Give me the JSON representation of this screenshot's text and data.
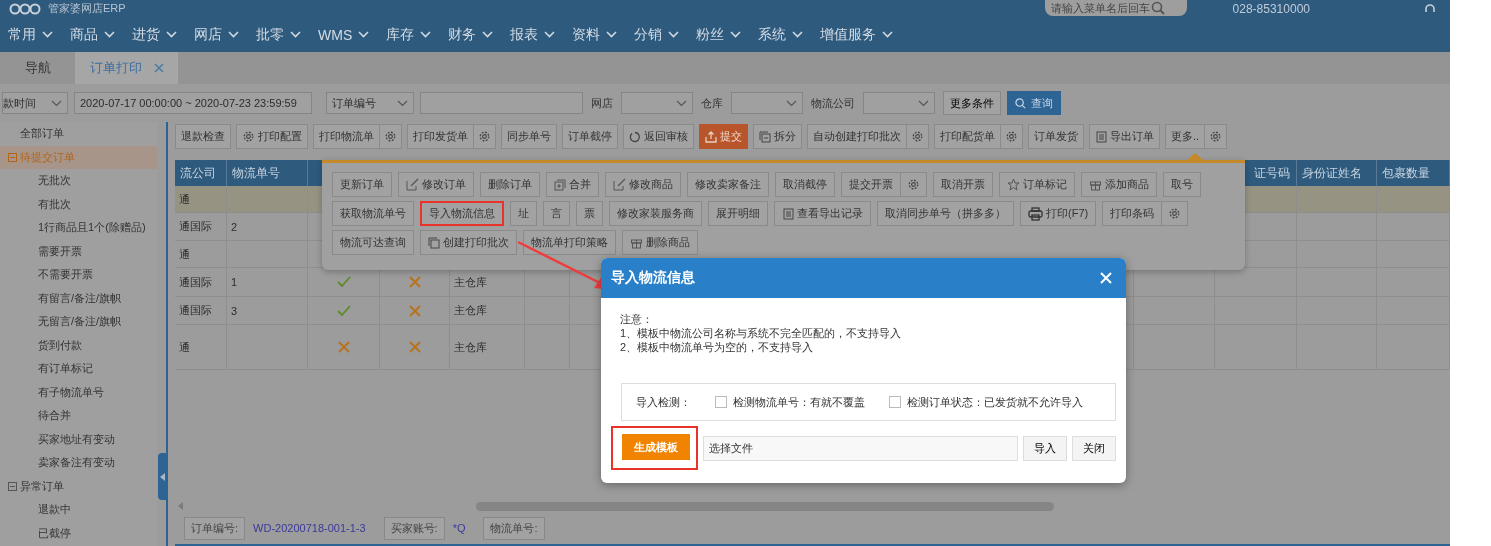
{
  "app": {
    "title": "管家婆网店ERP",
    "search": {
      "placeholder": "请输入菜单名后回车"
    },
    "phone": "028-85310000"
  },
  "menu": [
    {
      "label": "常用"
    },
    {
      "label": "商品"
    },
    {
      "label": "进货"
    },
    {
      "label": "网店"
    },
    {
      "label": "批零"
    },
    {
      "label": "WMS"
    },
    {
      "label": "库存"
    },
    {
      "label": "财务"
    },
    {
      "label": "报表"
    },
    {
      "label": "资料"
    },
    {
      "label": "分销"
    },
    {
      "label": "粉丝"
    },
    {
      "label": "系统"
    },
    {
      "label": "增值服务"
    }
  ],
  "tabs": [
    {
      "label": "导航",
      "selected": false,
      "closable": false
    },
    {
      "label": "订单打印",
      "selected": true,
      "closable": true
    }
  ],
  "filters": [
    {
      "kind": "select",
      "value": "款时间"
    },
    {
      "kind": "input",
      "value": "2020-07-17 00:00:00 ~ 2020-07-23 23:59:59"
    },
    {
      "kind": "select",
      "value": "订单编号"
    },
    {
      "kind": "input"
    },
    {
      "kind": "label",
      "text": "网店"
    },
    {
      "kind": "select"
    },
    {
      "kind": "label",
      "text": "仓库"
    },
    {
      "kind": "select"
    },
    {
      "kind": "label",
      "text": "物流公司"
    },
    {
      "kind": "select"
    },
    {
      "kind": "button",
      "label": "更多条件"
    },
    {
      "kind": "search",
      "label": "查询"
    }
  ],
  "sidebar": {
    "items": [
      {
        "label": "全部订单",
        "selected": false
      },
      {
        "label": "待提交订单",
        "selected": true,
        "expanded": true,
        "children": [
          {
            "label": "无批次",
            "selected": false
          },
          {
            "label": "有批次",
            "selected": false
          },
          {
            "label": "1行商品且1个(除赠品)",
            "selected": false
          },
          {
            "label": "需要开票",
            "selected": false
          },
          {
            "label": "不需要开票",
            "selected": false
          },
          {
            "label": "有留言/备注/旗帜",
            "selected": false
          },
          {
            "label": "无留言/备注/旗帜",
            "selected": false
          },
          {
            "label": "货到付款",
            "selected": false
          },
          {
            "label": "有订单标记",
            "selected": false
          },
          {
            "label": "有子物流单号",
            "selected": false
          },
          {
            "label": "待合并",
            "selected": false
          },
          {
            "label": "买家地址有变动",
            "selected": false
          },
          {
            "label": "卖家备注有变动",
            "selected": false
          }
        ]
      },
      {
        "label": "异常订单",
        "selected": false,
        "expanded": true,
        "children": [
          {
            "label": "退款中",
            "selected": false
          },
          {
            "label": "已截停",
            "selected": false
          }
        ]
      }
    ]
  },
  "toolbar": [
    {
      "label": "退款检查",
      "kind": "plain"
    },
    {
      "label": "打印配置",
      "kind": "config"
    },
    {
      "label": "打印物流单",
      "kind": "split"
    },
    {
      "label": "打印发货单",
      "kind": "split"
    },
    {
      "label": "同步单号",
      "kind": "plain"
    },
    {
      "label": "订单截停",
      "kind": "plain"
    },
    {
      "label": "返回审核",
      "kind": "undo"
    },
    {
      "label": "提交",
      "kind": "submit"
    },
    {
      "label": "拆分",
      "kind": "copy"
    },
    {
      "label": "自动创建打印批次",
      "kind": "split"
    },
    {
      "label": "打印配货单",
      "kind": "split"
    },
    {
      "label": "订单发货",
      "kind": "plain"
    },
    {
      "label": "导出订单",
      "kind": "doc"
    },
    {
      "label": "更多..",
      "kind": "split"
    }
  ],
  "more_menu": {
    "rows": [
      {
        "buttons": [
          {
            "label": "更新订单",
            "kind": "plain",
            "highlighted": false
          },
          {
            "label": "修改订单",
            "kind": "edit",
            "highlighted": false
          },
          {
            "label": "删除订单",
            "kind": "plain",
            "highlighted": false
          },
          {
            "label": "合并",
            "kind": "merge",
            "highlighted": false
          },
          {
            "label": "修改商品",
            "kind": "edit",
            "highlighted": false
          },
          {
            "label": "修改卖家备注",
            "kind": "plain",
            "highlighted": false
          },
          {
            "label": "取消截停",
            "kind": "plain",
            "highlighted": false
          },
          {
            "label": "提交开票",
            "kind": "split",
            "highlighted": false
          },
          {
            "label": "取消开票",
            "kind": "plain",
            "highlighted": false
          },
          {
            "label": "订单标记",
            "kind": "star",
            "highlighted": false
          },
          {
            "label": "添加商品",
            "kind": "gift",
            "highlighted": false
          },
          {
            "label": "取号",
            "kind": "plain",
            "highlighted": false
          }
        ]
      },
      {
        "buttons": [
          {
            "label": "获取物流单号",
            "kind": "plain",
            "highlighted": false
          },
          {
            "label": "导入物流信息",
            "kind": "plain",
            "highlighted": true
          },
          {
            "label": "址",
            "kind": "plain",
            "highlighted": false
          },
          {
            "label": "言",
            "kind": "plain",
            "highlighted": false
          },
          {
            "label": "票",
            "kind": "plain",
            "highlighted": false
          },
          {
            "label": "修改家装服务商",
            "kind": "plain",
            "highlighted": false
          },
          {
            "label": "展开明细",
            "kind": "plain",
            "highlighted": false
          },
          {
            "label": "查看导出记录",
            "kind": "doc",
            "highlighted": false
          },
          {
            "label": "取消同步单号（拼多多）",
            "kind": "plain",
            "highlighted": false
          },
          {
            "label": "打印(F7)",
            "kind": "print",
            "highlighted": false
          },
          {
            "label": "打印条码",
            "kind": "split",
            "highlighted": false
          }
        ]
      },
      {
        "buttons": [
          {
            "label": "物流可达查询",
            "kind": "plain",
            "highlighted": false
          },
          {
            "label": "创建打印批次",
            "kind": "copy",
            "highlighted": false
          },
          {
            "label": "物流单打印策略",
            "kind": "plain",
            "highlighted": false
          },
          {
            "label": "删除商品",
            "kind": "gift",
            "highlighted": false
          }
        ]
      }
    ]
  },
  "table": {
    "columns": [
      {
        "label": "流公司"
      },
      {
        "label": "物流单号"
      },
      {},
      {},
      {},
      {},
      {},
      {},
      {
        "label": "证号码"
      },
      {
        "label": "身份证姓名"
      },
      {
        "label": "包裹数量"
      }
    ],
    "rows": [
      {
        "selected": true,
        "company": "通"
      },
      {
        "selected": false,
        "company": "通国际",
        "tracking_no": "2"
      },
      {
        "selected": false,
        "company": "通"
      },
      {
        "selected": false,
        "company": "通国际",
        "tracking_no": "1",
        "column_3": true,
        "column_4": false,
        "warehouse": "主仓库"
      },
      {
        "selected": false,
        "company": "通国际",
        "tracking_no": "3",
        "column_3": true,
        "column_4": false,
        "warehouse": "主仓库"
      },
      {
        "selected": false,
        "company": "通",
        "column_3": false,
        "column_4": false,
        "warehouse": "主仓库"
      }
    ]
  },
  "status_bar": {
    "fields": [
      {
        "label": "订单编号:",
        "value": "WD-20200718-001-1-3"
      },
      {
        "label": "买家账号:",
        "value": "*Q"
      },
      {
        "label": "物流单号:"
      }
    ]
  },
  "dialog": {
    "title": "导入物流信息",
    "notes": [
      "注意：",
      "1、模板中物流公司名称与系统不完全匹配的，不支持导入",
      "2、模板中物流单号为空的，不支持导入"
    ],
    "check_label": "导入检测：",
    "checks": [
      {
        "label": "检测物流单号：有就不覆盖",
        "checked": false
      },
      {
        "label": "检测订单状态：已发货就不允许导入",
        "checked": false
      }
    ],
    "template_button": {
      "label": "生成模板",
      "highlighted": true
    },
    "file": {
      "value": "选择文件"
    },
    "buttons": [
      "导入",
      "关闭"
    ]
  }
}
